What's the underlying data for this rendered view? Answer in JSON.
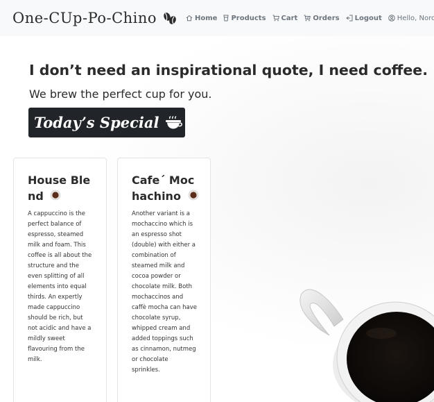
{
  "brand": {
    "name": "One-CUp-Po-Chino",
    "logo_icon": "coffee-beans-icon"
  },
  "nav": {
    "home": "Home",
    "products": "Products",
    "cart": "Cart",
    "orders": "Orders",
    "logout": "Logout",
    "greeting": "Hello, Noro"
  },
  "hero": {
    "title": "I don’t need an inspirational quote, I need coffee.",
    "subtitle": "We brew the perfect cup for you.",
    "special_button": "Today’s Special"
  },
  "cards": [
    {
      "title": "House Blend",
      "text": "A cappuccino is the perfect balance of espresso, steamed milk and foam. This coffee is all about the structure and the even splitting of all elements into equal thirds. An expertly made cappuccino should be rich, but not acidic and have a mildly sweet flavouring from the milk."
    },
    {
      "title": "Cafe´ Mochachino",
      "text": "Another variant is a mochaccino which is an espresso shot (double) with either a combination of steamed milk and cocoa powder or chocolate milk. Both mochaccinos and caffè mocha can have chocolate syrup, whipped cream and added toppings such as cinnamon, nutmeg or chocolate sprinkles."
    }
  ],
  "colors": {
    "navbar_bg": "#f8f9fa",
    "button_bg": "#212529",
    "nav_text": "#6c757d"
  }
}
